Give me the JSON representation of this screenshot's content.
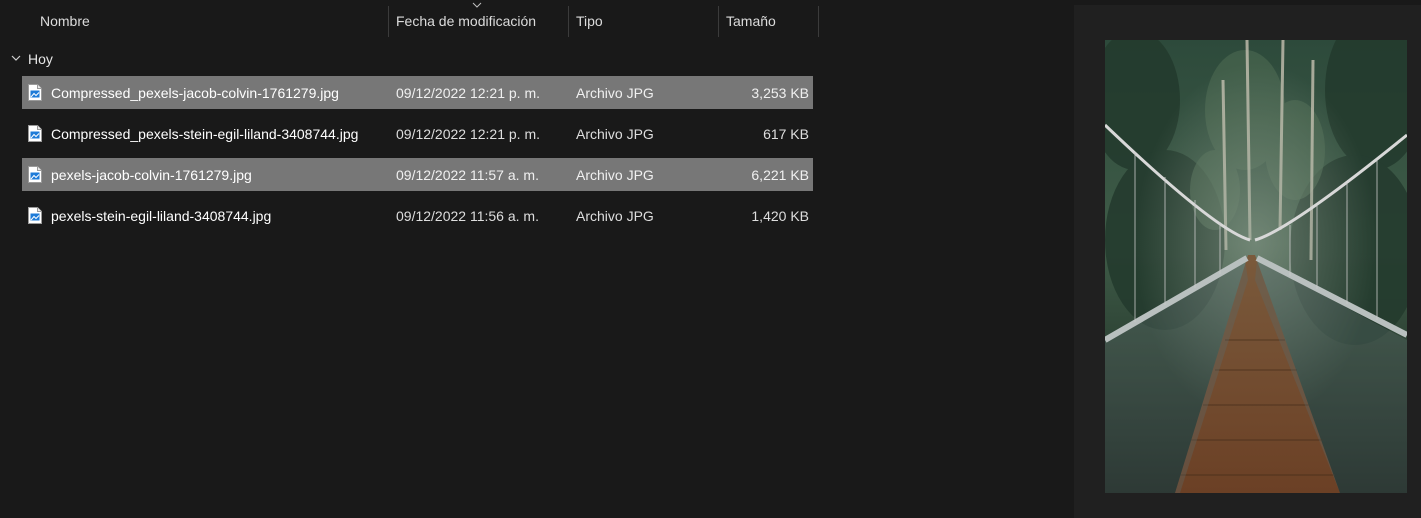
{
  "columns": {
    "name": "Nombre",
    "date": "Fecha de modificación",
    "type": "Tipo",
    "size": "Tamaño"
  },
  "group": {
    "label": "Hoy"
  },
  "files": [
    {
      "name": "Compressed_pexels-jacob-colvin-1761279.jpg",
      "date": "09/12/2022 12:21 p. m.",
      "type": "Archivo JPG",
      "size": "3,253 KB",
      "selected": true
    },
    {
      "name": "Compressed_pexels-stein-egil-liland-3408744.jpg",
      "date": "09/12/2022 12:21 p. m.",
      "type": "Archivo JPG",
      "size": "617 KB",
      "selected": false
    },
    {
      "name": "pexels-jacob-colvin-1761279.jpg",
      "date": "09/12/2022 11:57 a. m.",
      "type": "Archivo JPG",
      "size": "6,221 KB",
      "selected": true
    },
    {
      "name": "pexels-stein-egil-liland-3408744.jpg",
      "date": "09/12/2022 11:56 a. m.",
      "type": "Archivo JPG",
      "size": "1,420 KB",
      "selected": false
    }
  ],
  "icons": {
    "sort": "chevron-down-icon",
    "group_toggle": "chevron-down-icon",
    "file": "image-file-icon"
  },
  "colors": {
    "background": "#191919",
    "selection": "#777777",
    "preview_background": "#202020"
  }
}
